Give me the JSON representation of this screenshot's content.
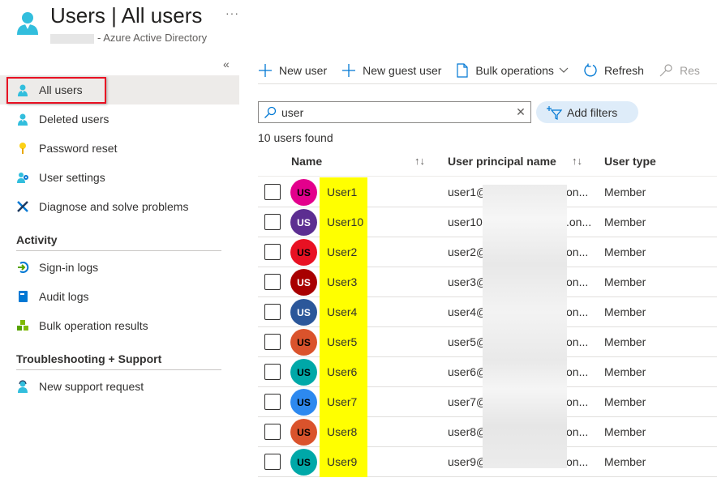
{
  "header": {
    "title": "Users | All users",
    "subtitle": "- Azure Active Directory",
    "more_label": "···",
    "collapse_label": "«"
  },
  "sidebar": {
    "items": [
      {
        "label": "All users",
        "icon": "user-icon",
        "active": true
      },
      {
        "label": "Deleted users",
        "icon": "user-icon"
      },
      {
        "label": "Password reset",
        "icon": "key-icon"
      },
      {
        "label": "User settings",
        "icon": "user-settings-icon"
      },
      {
        "label": "Diagnose and solve problems",
        "icon": "wrench-icon"
      }
    ],
    "sections": [
      {
        "title": "Activity",
        "items": [
          {
            "label": "Sign-in logs",
            "icon": "sign-in-icon"
          },
          {
            "label": "Audit logs",
            "icon": "book-icon"
          },
          {
            "label": "Bulk operation results",
            "icon": "cubes-icon"
          }
        ]
      },
      {
        "title": "Troubleshooting + Support",
        "items": [
          {
            "label": "New support request",
            "icon": "support-person-icon"
          }
        ]
      }
    ]
  },
  "toolbar": {
    "new_user": "New user",
    "new_guest_user": "New guest user",
    "bulk_operations": "Bulk operations",
    "refresh": "Refresh",
    "reset_password": "Res"
  },
  "search": {
    "value": "user",
    "placeholder": "Search"
  },
  "add_filters": "Add filters",
  "results_count": "10 users found",
  "table": {
    "columns": {
      "name": "Name",
      "upn": "User principal name",
      "type": "User type"
    },
    "sort_glyph": "↑↓",
    "rows": [
      {
        "initials": "US",
        "name": "User1",
        "upn": "user1@",
        "upn_tail": "on...",
        "type": "Member",
        "color": "#e3008c",
        "light": false
      },
      {
        "initials": "US",
        "name": "User10",
        "upn": "user10",
        "upn_tail": ".on...",
        "type": "Member",
        "color": "#5c2e91",
        "light": true
      },
      {
        "initials": "US",
        "name": "User2",
        "upn": "user2@",
        "upn_tail": "on...",
        "type": "Member",
        "color": "#e81123",
        "light": false
      },
      {
        "initials": "US",
        "name": "User3",
        "upn": "user3@",
        "upn_tail": "on...",
        "type": "Member",
        "color": "#a80000",
        "light": true
      },
      {
        "initials": "US",
        "name": "User4",
        "upn": "user4@",
        "upn_tail": "on...",
        "type": "Member",
        "color": "#2b579a",
        "light": true
      },
      {
        "initials": "US",
        "name": "User5",
        "upn": "user5@",
        "upn_tail": "on...",
        "type": "Member",
        "color": "#da532c",
        "light": false
      },
      {
        "initials": "US",
        "name": "User6",
        "upn": "user6@",
        "upn_tail": "on...",
        "type": "Member",
        "color": "#00a8a8",
        "light": false
      },
      {
        "initials": "US",
        "name": "User7",
        "upn": "user7@",
        "upn_tail": "on...",
        "type": "Member",
        "color": "#2d89ef",
        "light": false
      },
      {
        "initials": "US",
        "name": "User8",
        "upn": "user8@",
        "upn_tail": "on...",
        "type": "Member",
        "color": "#da532c",
        "light": false
      },
      {
        "initials": "US",
        "name": "User9",
        "upn": "user9@",
        "upn_tail": "on...",
        "type": "Member",
        "color": "#00a8a8",
        "light": false
      }
    ]
  },
  "colors": {
    "accent": "#0078d4",
    "highlight": "#ffff00",
    "selection_border": "#e81123"
  }
}
